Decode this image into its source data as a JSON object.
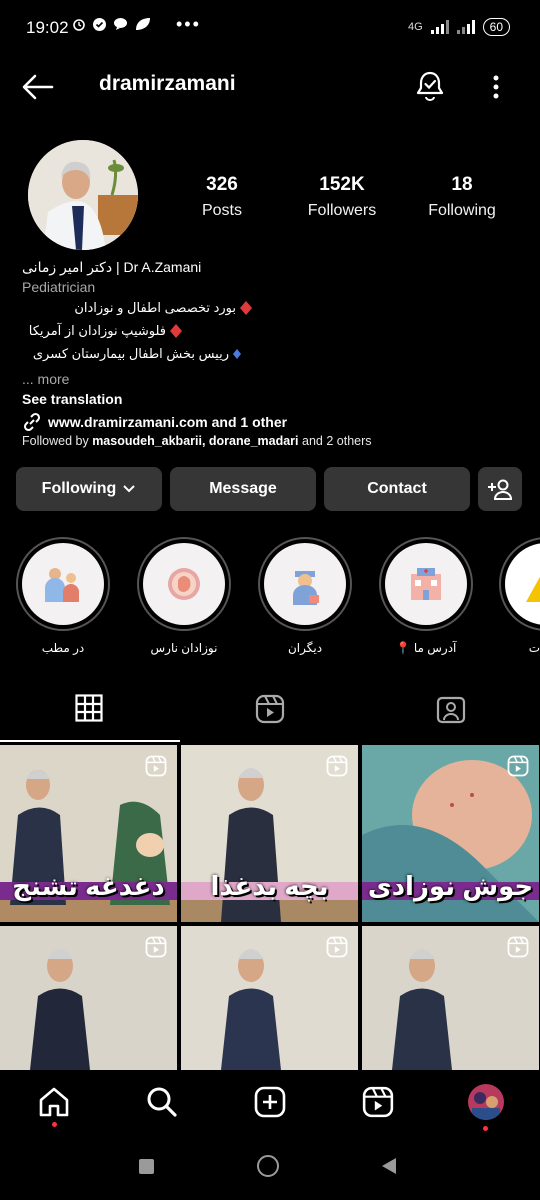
{
  "status_bar": {
    "time": "19:02",
    "signal_text": "4G",
    "battery": "60"
  },
  "header": {
    "username": "dramirzamani"
  },
  "profile": {
    "stats": [
      {
        "value": "326",
        "label": "Posts"
      },
      {
        "value": "152K",
        "label": "Followers"
      },
      {
        "value": "18",
        "label": "Following"
      }
    ],
    "name": "دکتر امیر زمانی | Dr A.Zamani",
    "category": "Pediatrician",
    "bio_lines": [
      "بورد تخصصی اطفال و نوزادان",
      "فلوشیپ نوزادان از آمریکا",
      "رییس بخش اطفال بیمارستان کسری"
    ],
    "more_label": "... more",
    "see_translation": "See translation",
    "link_text": "www.dramirzamani.com and 1 other",
    "followed_by_prefix": "Followed by",
    "followed_by_users": "masoudeh_akbarii, dorane_madari",
    "followed_by_suffix": "and 2 others"
  },
  "actions": {
    "following": "Following",
    "message": "Message",
    "contact": "Contact"
  },
  "highlights": [
    {
      "label": "در مطب"
    },
    {
      "label": "نوزادان نارس"
    },
    {
      "label": "دیگران"
    },
    {
      "label": "آدرس ما 📍"
    },
    {
      "label": "ت"
    }
  ],
  "posts": [
    {
      "caption": "دغدغه تشنج"
    },
    {
      "caption": "بچه بدغذا"
    },
    {
      "caption": "جوش نوزادی"
    },
    {
      "caption": ""
    },
    {
      "caption": ""
    },
    {
      "caption": ""
    }
  ],
  "colors": {
    "background": "#000000",
    "button": "#363636",
    "notification": "#ff3040"
  }
}
